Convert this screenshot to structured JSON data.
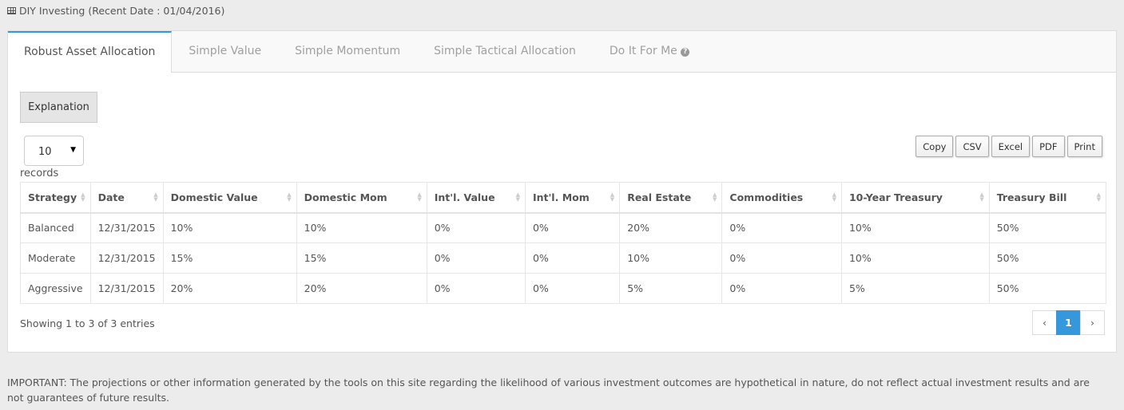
{
  "header": {
    "title": "DIY Investing (Recent Date : 01/04/2016)"
  },
  "tabs": [
    {
      "label": "Robust Asset Allocation"
    },
    {
      "label": "Simple Value"
    },
    {
      "label": "Simple Momentum"
    },
    {
      "label": "Simple Tactical Allocation"
    },
    {
      "label": "Do It For Me"
    }
  ],
  "explanation_label": "Explanation",
  "length": {
    "value": "10",
    "suffix": "records"
  },
  "export_buttons": [
    "Copy",
    "CSV",
    "Excel",
    "PDF",
    "Print"
  ],
  "table": {
    "columns": [
      "Strategy",
      "Date",
      "Domestic Value",
      "Domestic Mom",
      "Int'l. Value",
      "Int'l. Mom",
      "Real Estate",
      "Commodities",
      "10-Year Treasury",
      "Treasury Bill"
    ],
    "rows": [
      [
        "Balanced",
        "12/31/2015",
        "10%",
        "10%",
        "0%",
        "0%",
        "20%",
        "0%",
        "10%",
        "50%"
      ],
      [
        "Moderate",
        "12/31/2015",
        "15%",
        "15%",
        "0%",
        "0%",
        "10%",
        "0%",
        "10%",
        "50%"
      ],
      [
        "Aggressive",
        "12/31/2015",
        "20%",
        "20%",
        "0%",
        "0%",
        "5%",
        "0%",
        "5%",
        "50%"
      ]
    ]
  },
  "info": "Showing 1 to 3 of 3 entries",
  "pagination": {
    "prev": "‹",
    "current": "1",
    "next": "›"
  },
  "disclaimer": "IMPORTANT: The projections or other information generated by the tools on this site regarding the likelihood of various investment outcomes are hypothetical in nature, do not reflect actual investment results and are not guarantees of future results.",
  "colors": {
    "accent": "#3598dc"
  }
}
